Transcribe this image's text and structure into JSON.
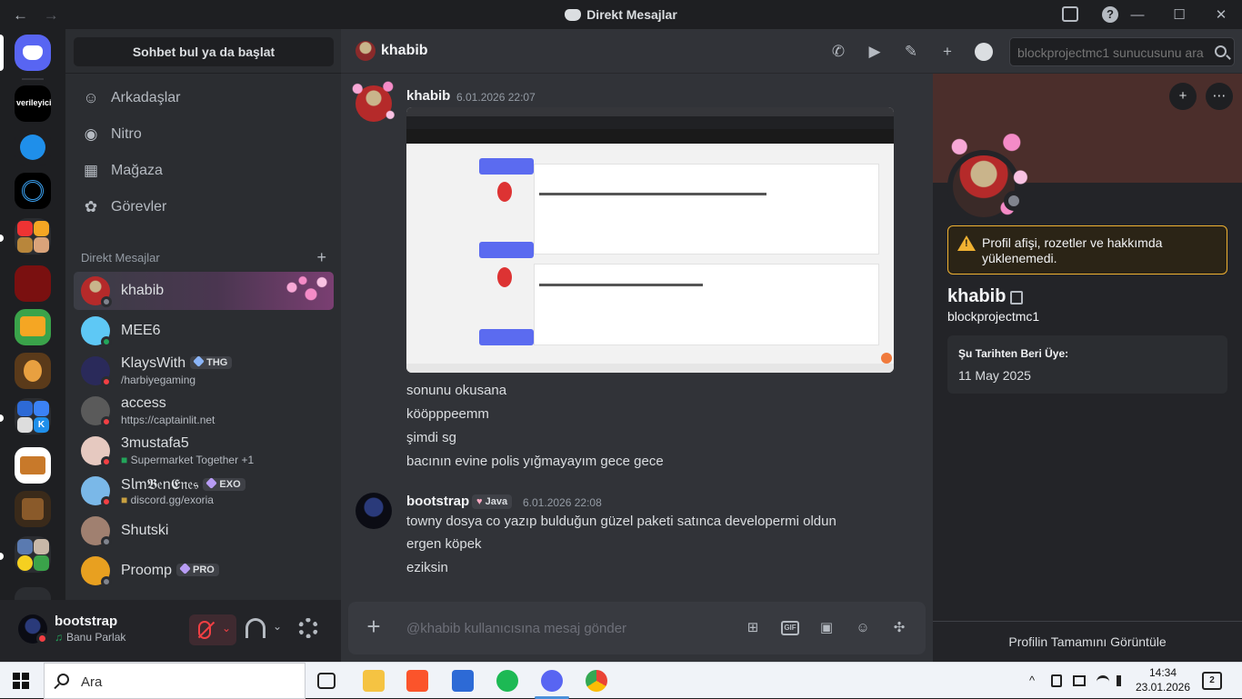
{
  "window": {
    "title": "Direkt Mesajlar",
    "back_glyph": "←",
    "forward_glyph": "→",
    "minimize_glyph": "—",
    "maximize_glyph": "☐",
    "close_glyph": "✕",
    "help_glyph": "?"
  },
  "servers": {
    "verileyici_label": "verileyici",
    "folder_k_label": "K"
  },
  "dm_sidebar": {
    "search_label": "Sohbet bul ya da başlat",
    "nav": [
      {
        "label": "Arkadaşlar",
        "icon": "friends-icon"
      },
      {
        "label": "Nitro",
        "icon": "nitro-icon"
      },
      {
        "label": "Mağaza",
        "icon": "shop-icon"
      },
      {
        "label": "Görevler",
        "icon": "quests-icon"
      }
    ],
    "section_title": "Direkt Mesajlar",
    "add_glyph": "+",
    "items": [
      {
        "name": "khabib",
        "status": "offline",
        "active": true
      },
      {
        "name": "MEE6",
        "status": "online"
      },
      {
        "name": "KlaysWith",
        "tag": "THG",
        "sub": "/harbiyegaming",
        "status": "dnd"
      },
      {
        "name": "access",
        "sub": "https://captainlit.net",
        "status": "dnd"
      },
      {
        "name": "3mustafa5",
        "sub": "Supermarket Together +1",
        "status": "dnd"
      },
      {
        "name": "S𝗅m𝕭𝔢n𝕰𝔫𝔢𝔰",
        "tag": "EXO",
        "sub": "discord.gg/exoria",
        "status": "dnd"
      },
      {
        "name": "Shutski",
        "status": "offline"
      },
      {
        "name": "Proomp",
        "tag": "PRO",
        "status": "offline"
      }
    ]
  },
  "user_panel": {
    "name": "bootstrap",
    "activity": "Banu Parlak",
    "music_glyph": "♫",
    "chevron_glyph": "⌄"
  },
  "chat": {
    "channel_name": "khabib",
    "search_placeholder": "blockprojectmc1 sunucusunu ara",
    "header_icons": {
      "call": "✆",
      "video": "▶",
      "pin": "✎",
      "add": "+"
    },
    "messages": [
      {
        "author": "khabib",
        "time": "6.01.2026 22:07",
        "lines": [
          "sonunu okusana",
          "kööpppeemm",
          "şimdi sg",
          "bacının evine polis yığmayayım gece gece"
        ]
      },
      {
        "author": "bootstrap",
        "badge": "Java",
        "time": "6.01.2026 22:08",
        "lines": [
          "towny dosya co yazıp bulduğun güzel paketi satınca developermi oldun",
          "ergen köpek",
          "eziksin"
        ]
      }
    ],
    "composer_placeholder": "@khabib kullanıcısına mesaj gönder",
    "composer_plus": "+",
    "gif_label": "GIF",
    "composer_icons": {
      "gift": "⊞",
      "sticker": "▣",
      "emoji": "☺",
      "apps": "✣"
    }
  },
  "profile": {
    "name": "khabib",
    "username": "blockprojectmc1",
    "warning": "Profil afişi, rozetler ve hakkımda yüklenemedi.",
    "member_since_label": "Şu Tarihten Beri Üye:",
    "member_since": "11 May 2025",
    "view_full": "Profilin Tamamını Görüntüle",
    "add_friend_glyph": "+",
    "more_glyph": "⋯"
  },
  "taskbar": {
    "search_placeholder": "Ara",
    "time": "14:34",
    "date": "23.01.2026",
    "notifications": "2",
    "tray_up_glyph": "^"
  }
}
